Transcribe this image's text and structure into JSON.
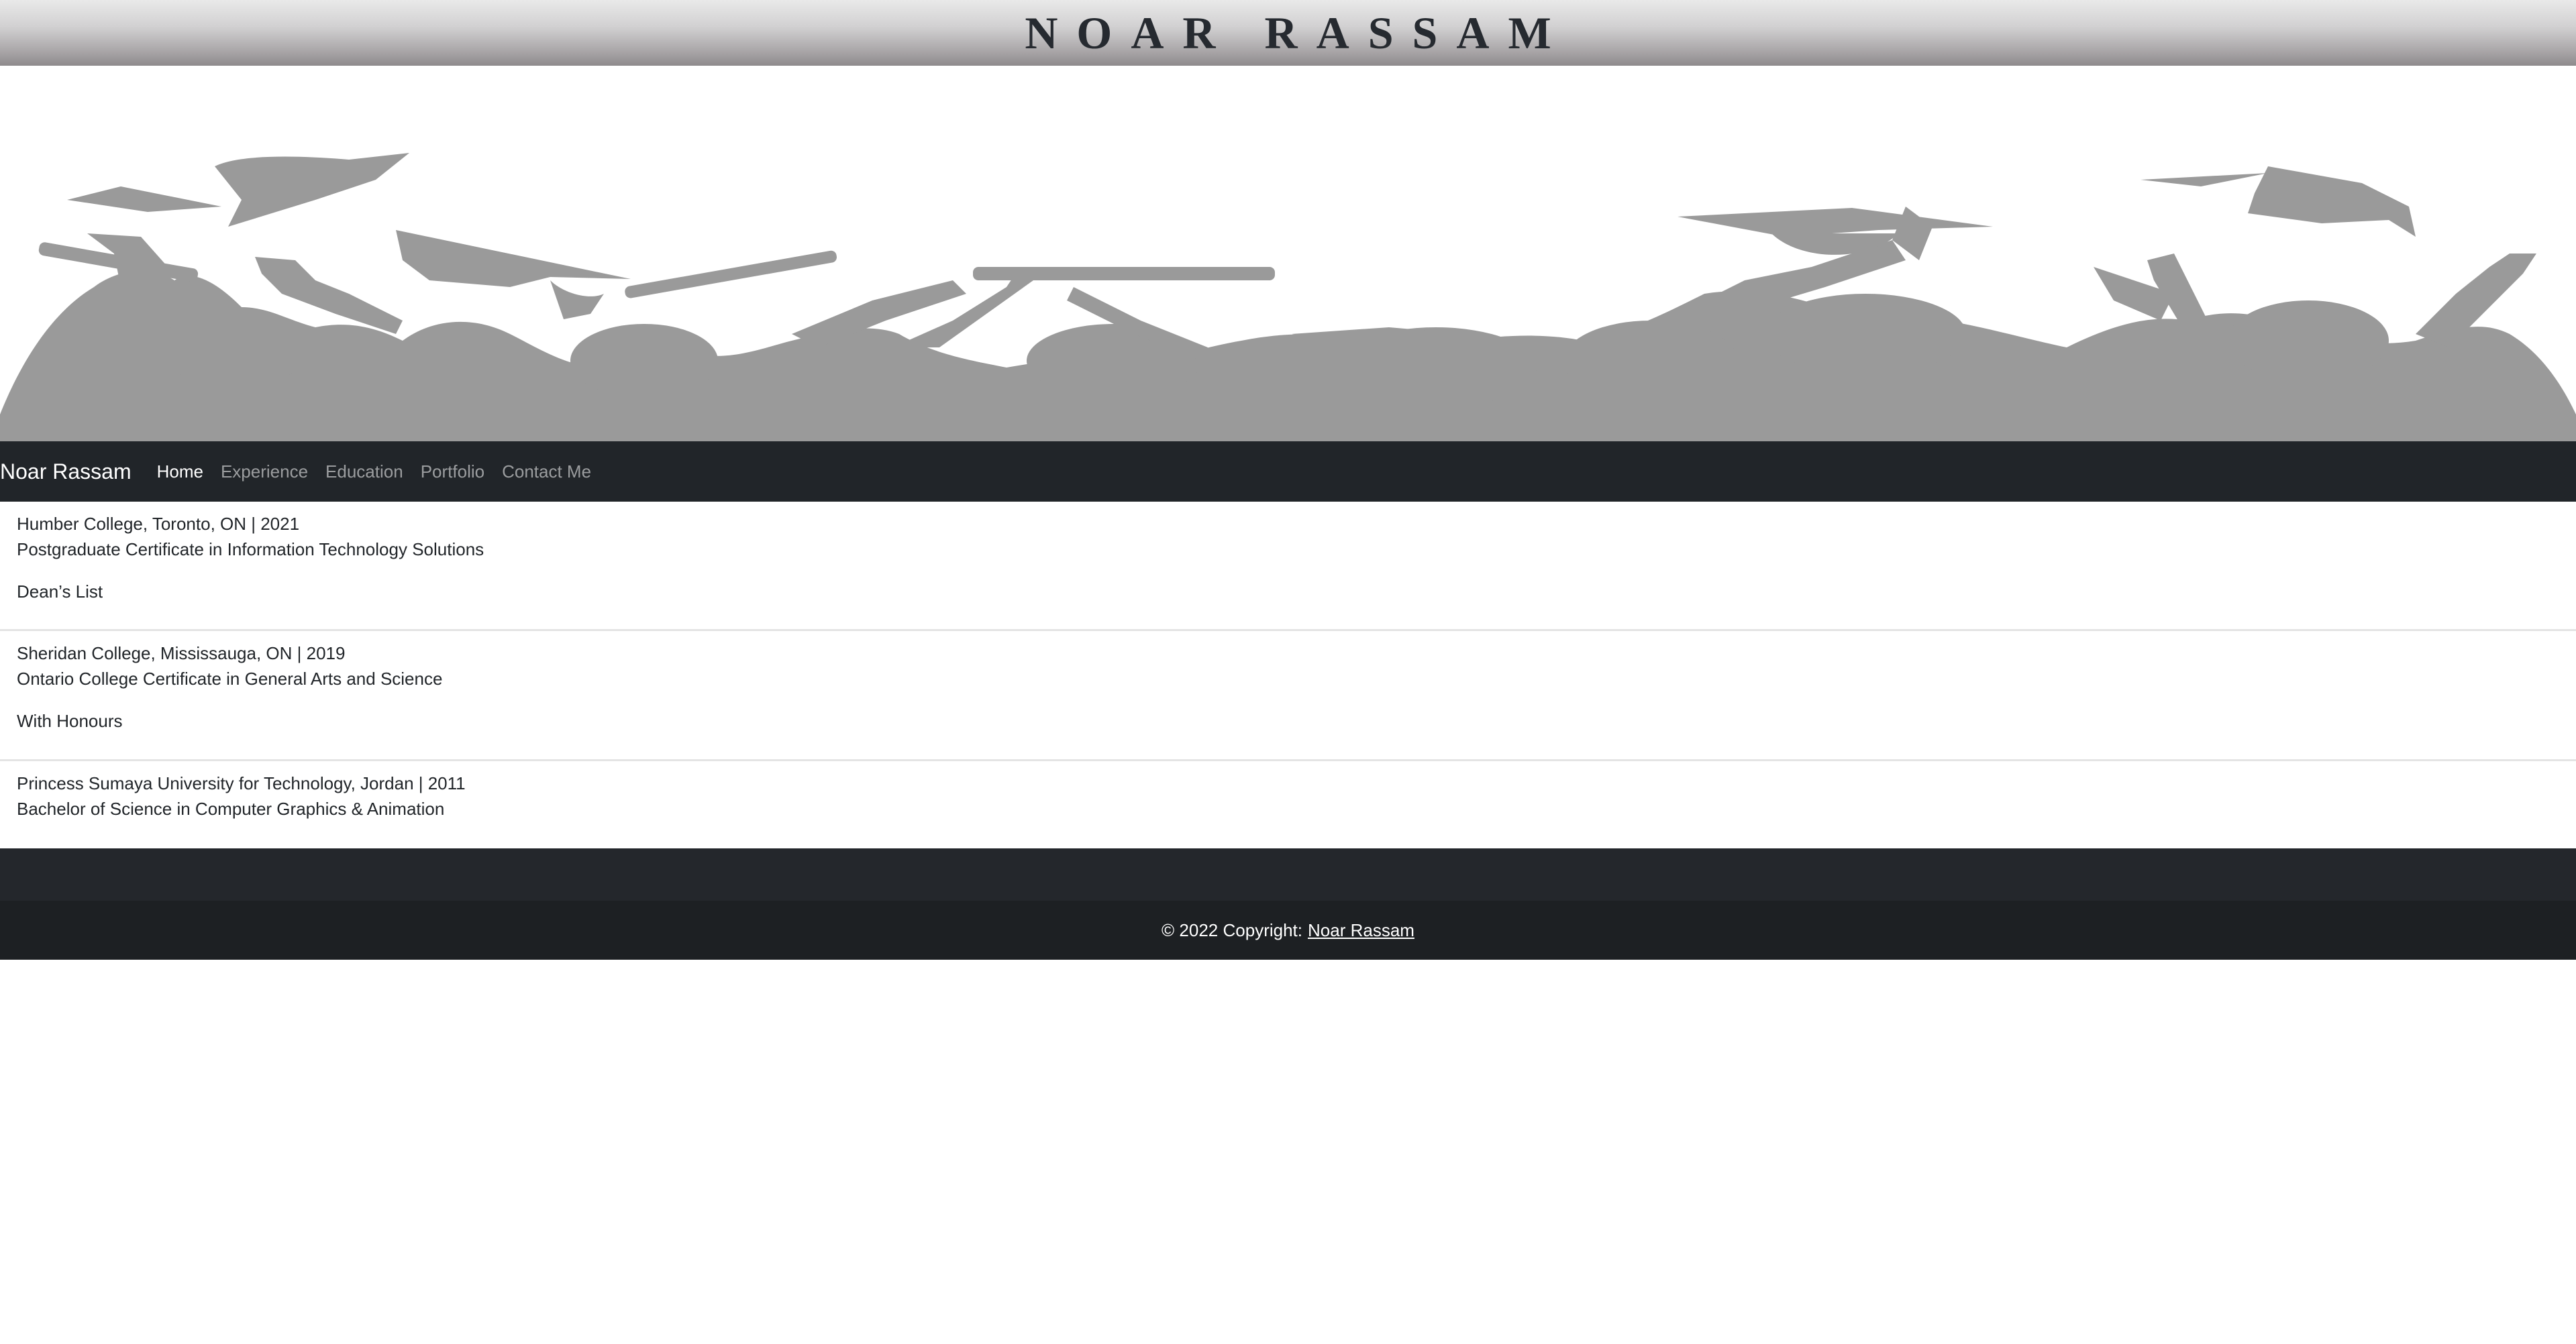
{
  "site_title": "NOAR RASSAM",
  "navbar": {
    "brand": "Noar Rassam",
    "links": [
      {
        "label": "Home",
        "active": true
      },
      {
        "label": "Experience",
        "active": false
      },
      {
        "label": "Education",
        "active": false
      },
      {
        "label": "Portfolio",
        "active": false
      },
      {
        "label": "Contact Me",
        "active": false
      }
    ]
  },
  "education": [
    {
      "institution": "Humber College, Toronto, ON | 2021",
      "credential": "Postgraduate Certificate in Information Technology Solutions",
      "honor": "Dean’s List"
    },
    {
      "institution": "Sheridan College, Mississauga, ON | 2019",
      "credential": "Ontario College Certificate in General Arts and Science",
      "honor": "With Honours"
    },
    {
      "institution": "Princess Sumaya University for Technology, Jordan | 2011",
      "credential": "Bachelor of Science in Computer Graphics & Animation"
    }
  ],
  "footer": {
    "copyright": "© 2022 Copyright:",
    "link_label": "Noar Rassam"
  },
  "colors": {
    "navbar_bg": "#212529",
    "silhouette": "#9a9a9a",
    "footer_top": "#24272c",
    "footer_bottom": "#1d2023"
  }
}
